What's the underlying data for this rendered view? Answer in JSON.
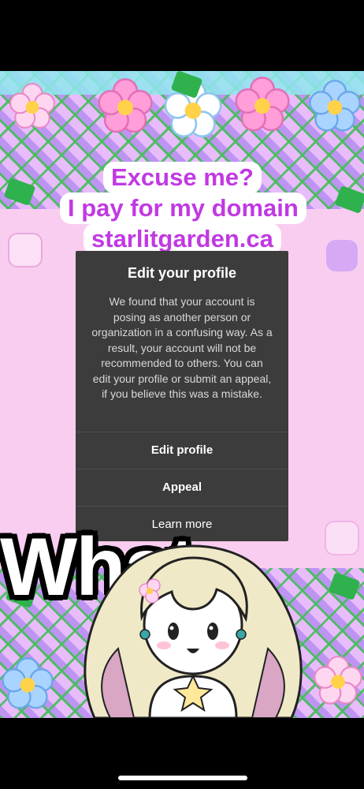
{
  "caption": {
    "line1": "Excuse me?",
    "line2": "I pay for my domain",
    "line3": "starlitgarden.ca"
  },
  "dialog": {
    "title": "Edit your profile",
    "body": "We found that your account is posing as another person or organization in a confusing way. As a result, your account will not be recommended to others. You can edit your profile or submit an appeal, if you believe this was a mistake.",
    "edit_profile_label": "Edit profile",
    "appeal_label": "Appeal",
    "learn_more_label": "Learn more"
  },
  "overlay_text": "What",
  "colors": {
    "caption_text": "#c139e3",
    "dialog_bg": "#3c3c3c",
    "scene_pink": "#f9cdf0",
    "pattern_purple": "#e3b5f6",
    "leaf_green": "#2fb24d"
  }
}
